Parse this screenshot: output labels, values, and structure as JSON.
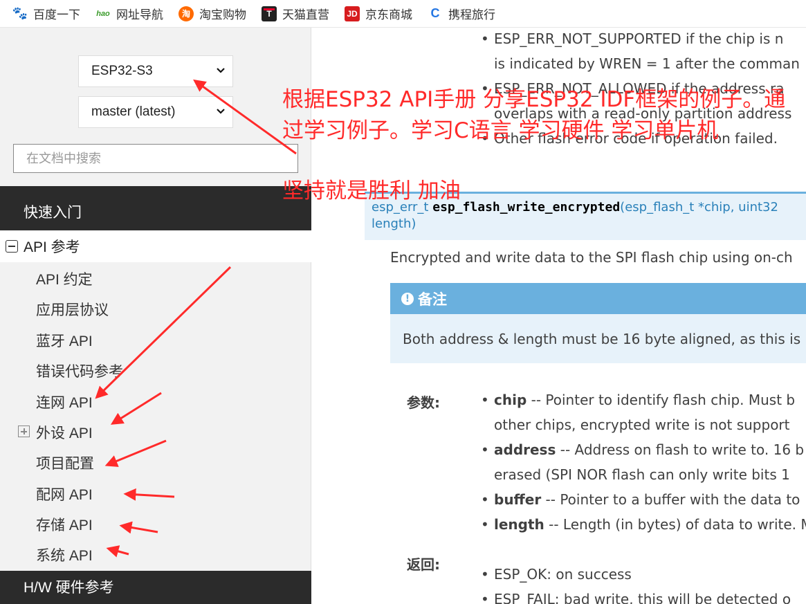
{
  "bookmarks": [
    {
      "label": "百度一下",
      "icon": "baidu-icon"
    },
    {
      "label": "网址导航",
      "icon": "hao123-icon"
    },
    {
      "label": "淘宝购物",
      "icon": "taobao-icon"
    },
    {
      "label": "天猫直营",
      "icon": "tmall-icon"
    },
    {
      "label": "京东商城",
      "icon": "jd-icon"
    },
    {
      "label": "携程旅行",
      "icon": "ctrip-icon"
    }
  ],
  "icon_glyphs": {
    "baidu": "🐾",
    "hao": "hao",
    "tao": "淘",
    "tmall": "T",
    "jd": "JD",
    "ctrip": "C"
  },
  "sidebar": {
    "target_select": "ESP32-S3",
    "version_select": "master (latest)",
    "search_placeholder": "在文档中搜索",
    "quick_start": "快速入门",
    "api_reference": "API 参考",
    "items": [
      "API 约定",
      "应用层协议",
      "蓝牙 API",
      "错误代码参考",
      "连网 API",
      "外设 API",
      "项目配置",
      "配网 API",
      "存储 API",
      "系统 API"
    ],
    "next_section_partial": "H/W 硬件参考"
  },
  "content": {
    "top_bullets": [
      "ESP_ERR_NOT_SUPPORTED if the chip is n",
      "is indicated by WREN = 1 after the comman",
      "ESP_ERR_NOT_ALLOWED if the address ra",
      "overlaps with a read-only partition address",
      "Other flash error code if operation failed."
    ],
    "signature": {
      "return_type": "esp_err_t",
      "function_name": "esp_flash_write_encrypted",
      "args": "(esp_flash_t *chip, uint32",
      "args_line2": "length)"
    },
    "description": "Encrypted and write data to the SPI flash chip using on-ch",
    "note": {
      "title": "备注",
      "body": "Both address & length must be 16 byte aligned, as this is"
    },
    "params_label": "参数:",
    "params": [
      {
        "name": "chip",
        "text": " -- Pointer to identify flash chip. Must b",
        "text2": "other chips, encrypted write is not support"
      },
      {
        "name": "address",
        "text": " -- Address on flash to write to. 16 b",
        "text2": "erased (SPI NOR flash can only write bits 1"
      },
      {
        "name": "buffer",
        "text": " -- Pointer to a buffer with the data to"
      },
      {
        "name": "length",
        "text": " -- Length (in bytes) of data to write. M"
      }
    ],
    "returns_label": "返回:",
    "returns": [
      "ESP_OK: on success",
      "ESP_FAIL: bad write, this will be detected o"
    ]
  },
  "annotation": {
    "line1": "根据ESP32 API手册 分享ESP32 IDF框架的例子。通",
    "line2": "过学习例子。学习C语言 学习硬件 学习单片机",
    "line3": "坚持就是胜利 加油",
    "color": "#ff2a2a"
  }
}
